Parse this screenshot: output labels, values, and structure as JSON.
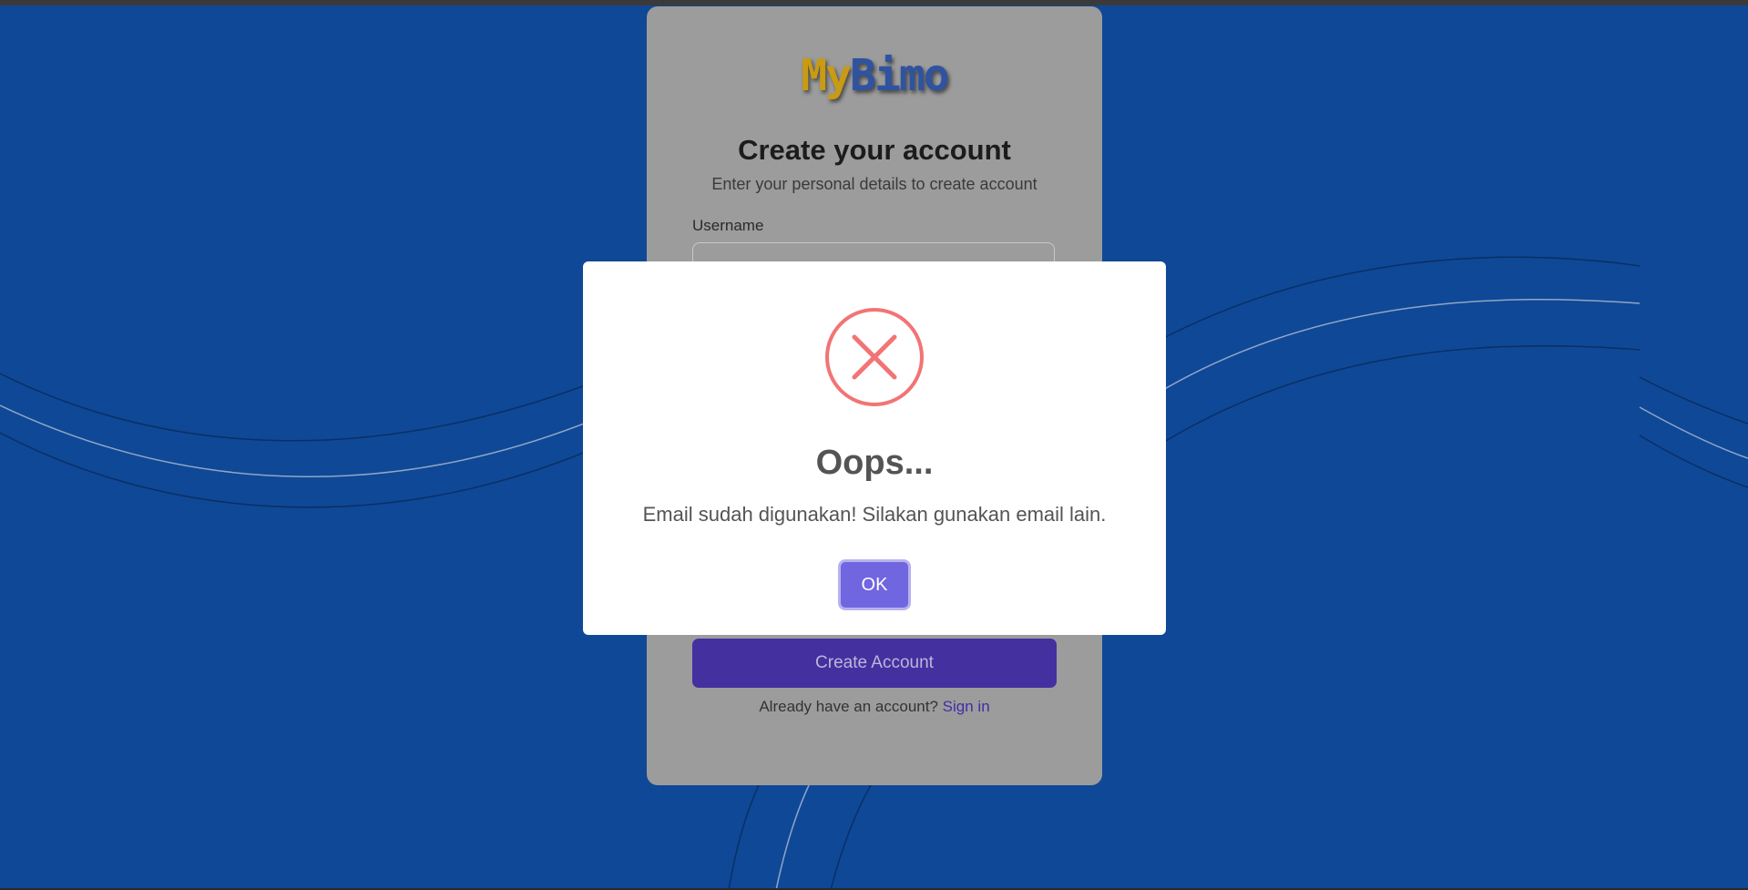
{
  "colors": {
    "background": "#0f4896",
    "card_overlay": "#9c9c9c",
    "primary_button": "#4530a0",
    "modal_confirm": "#7066e0",
    "error_icon": "#f27474"
  },
  "brand": {
    "logo_part1": "My",
    "logo_part2": "Bimo"
  },
  "form": {
    "title": "Create your account",
    "subtitle": "Enter your personal details to create account",
    "username_label": "Username",
    "username_value": "",
    "create_button": "Create Account",
    "signin_prompt": "Already have an account?",
    "signin_link": "Sign in"
  },
  "modal": {
    "icon": "error-x-icon",
    "title": "Oops...",
    "message": "Email sudah digunakan! Silakan gunakan email lain.",
    "confirm_button": "OK"
  }
}
